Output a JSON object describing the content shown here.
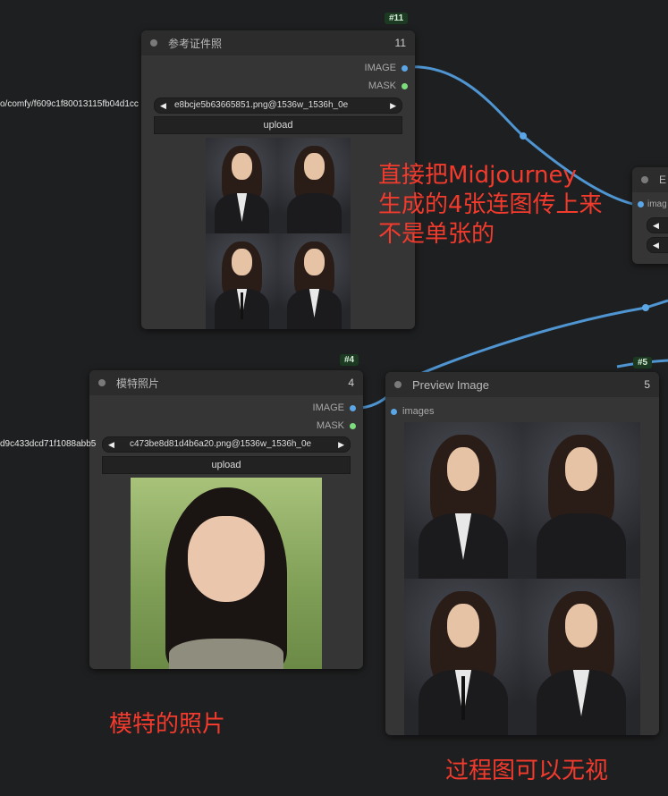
{
  "nodes": {
    "ref": {
      "badge": "#11",
      "title": "参考证件照",
      "number": "11",
      "outputs": [
        "IMAGE",
        "MASK"
      ],
      "image_path_left": "o/comfy/f609c1f80013115fb04d1cc",
      "image_file": "e8bcje5b63665851.png@1536w_1536h_0e",
      "upload_label": "upload"
    },
    "model": {
      "badge": "#4",
      "title": "模特照片",
      "number": "4",
      "outputs": [
        "IMAGE",
        "MASK"
      ],
      "image_path_left": "d9c433dcd71f1088abb5",
      "image_file": "c473be8d81d4b6a20.png@1536w_1536h_0e",
      "upload_label": "upload"
    },
    "preview": {
      "badge": "#5",
      "title": "Preview Image",
      "number": "5",
      "input": "images"
    },
    "partial": {
      "title": "E",
      "input": "imag"
    }
  },
  "annotations": {
    "note1": [
      "直接把Midjourney",
      "生成的4张连图传上来",
      "不是单张的"
    ],
    "note2": "模特的照片",
    "note3": "过程图可以无视"
  },
  "colors": {
    "link": "#5aa6e6",
    "annotation": "#f23a2d",
    "badge_bg": "#1c3a22"
  }
}
